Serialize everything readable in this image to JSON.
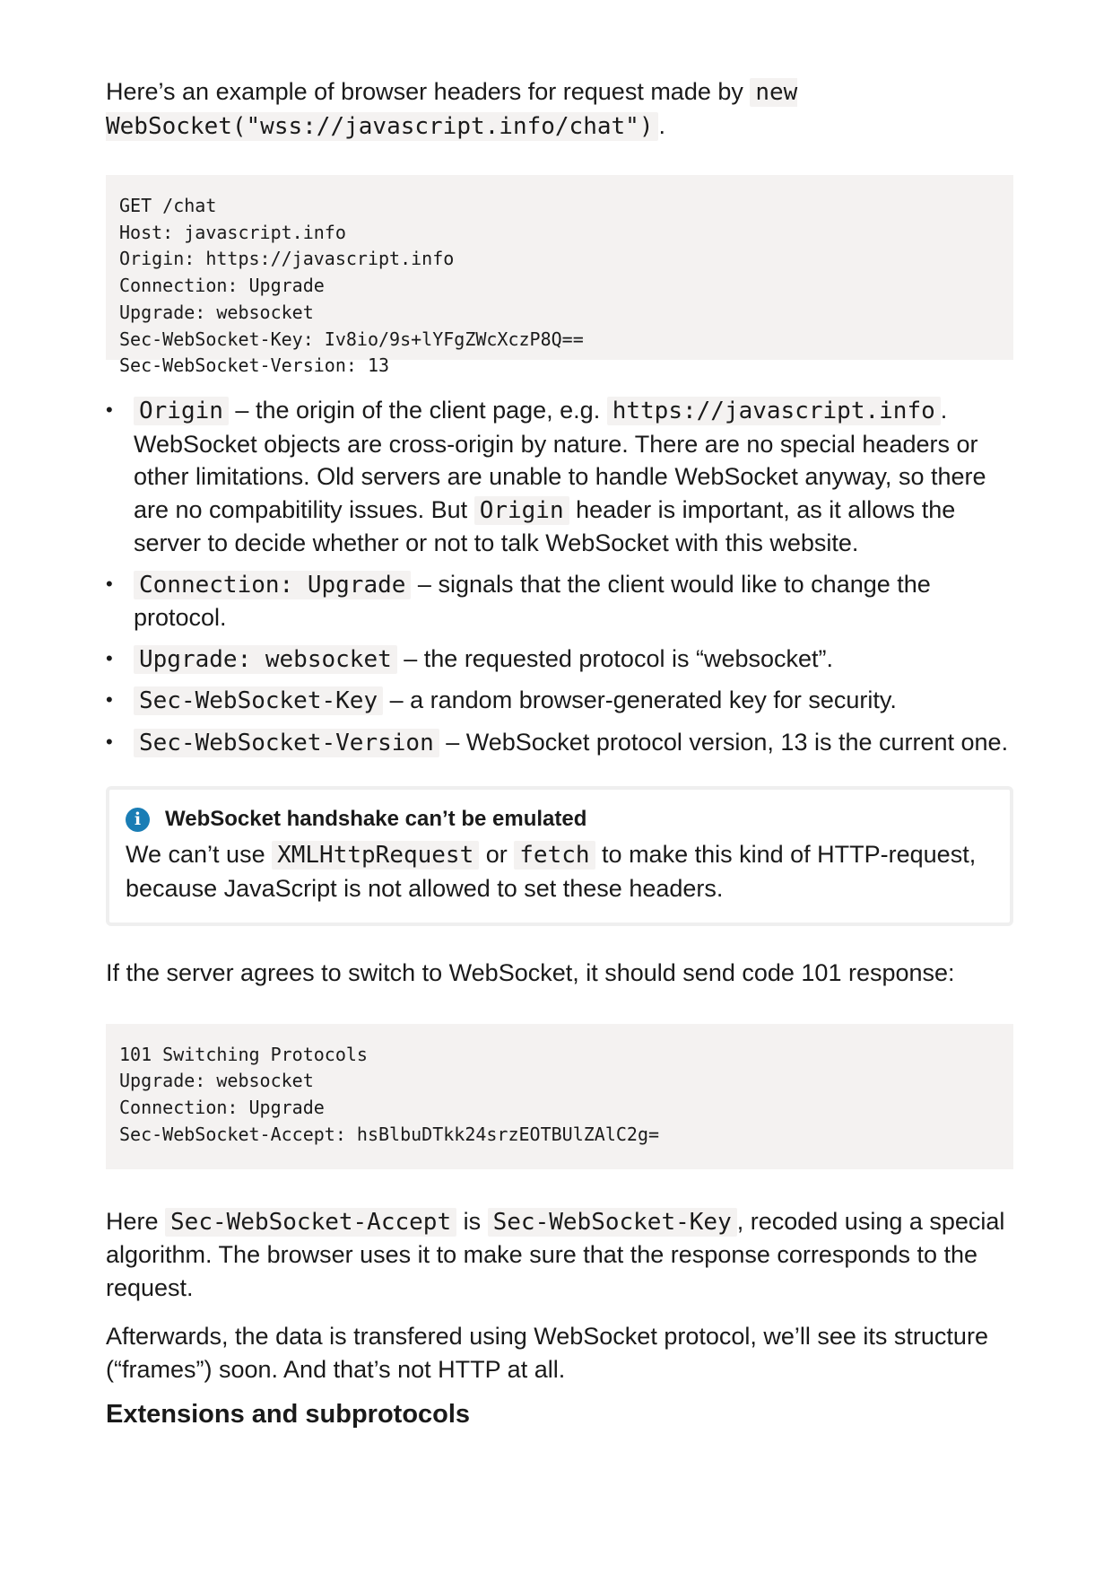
{
  "intro": {
    "text": "Here’s an example of browser headers for request made by ",
    "code": "new WebSocket(\"wss://javascript.info/chat\")",
    "after": "."
  },
  "request_block": [
    "GET /chat",
    "Host: javascript.info",
    "Origin: https://javascript.info",
    "Connection: Upgrade",
    "Upgrade: websocket",
    "Sec-WebSocket-Key: Iv8io/9s+lYFgZWcXczP8Q==",
    "Sec-WebSocket-Version: 13"
  ],
  "bullets": {
    "b1": {
      "code": "Origin",
      "t1": " – the origin of the client page, e.g. ",
      "code2": "https://javascript.info",
      "t2": ". WebSocket objects are cross-origin by nature. There are no special headers or other limitations. Old servers are unable to handle WebSocket anyway, so there are no compabitility issues. But ",
      "code3": "Origin",
      "t3": " header is important, as it allows the server to decide whether or not to talk WebSocket with this website."
    },
    "b2": {
      "code": "Connection: Upgrade",
      "text": " – signals that the client would like to change the protocol."
    },
    "b3": {
      "code": "Upgrade: websocket",
      "text": " – the requested protocol is “websocket”."
    },
    "b4": {
      "code": "Sec-WebSocket-Key",
      "text": " – a random browser-generated key for security."
    },
    "b5": {
      "code": "Sec-WebSocket-Version",
      "text": " – WebSocket protocol version, 13 is the current one."
    }
  },
  "notice": {
    "icon": "info-icon",
    "icon_glyph": "i",
    "title": "WebSocket handshake can’t be emulated",
    "t1": "We can’t use ",
    "code1": "XMLHttpRequest",
    "t2": " or ",
    "code2": "fetch",
    "t3": " to make this kind of HTTP-request, because JavaScript is not allowed to set these headers."
  },
  "response_intro": "If the server agrees to switch to WebSocket, it should send code 101 response:",
  "response_block": [
    "101 Switching Protocols",
    "Upgrade: websocket",
    "Connection: Upgrade",
    "Sec-WebSocket-Accept: hsBlbuDTkk24srzEOTBUlZAlC2g="
  ],
  "accept_para": {
    "t1": "Here ",
    "code1": "Sec-WebSocket-Accept",
    "t2": " is ",
    "code2": "Sec-WebSocket-Key",
    "t3": ", recoded using a special algorithm. The browser uses it to make sure that the response corresponds to the request."
  },
  "afterwards_para": "Afterwards, the data is transfered using WebSocket protocol, we’ll see its structure (“frames”) soon. And that’s not HTTP at all.",
  "heading": "Extensions and subprotocols",
  "bullet_glyph": "•"
}
